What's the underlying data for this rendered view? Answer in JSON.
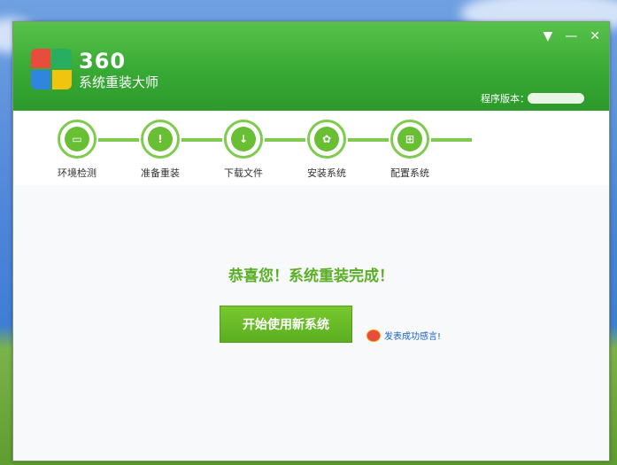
{
  "window": {
    "brand_number": "360",
    "brand_name": "系统重装大师",
    "version_label": "程序版本：",
    "controls": {
      "menu": "▼",
      "minimize": "—",
      "close": "✕"
    }
  },
  "steps": [
    {
      "label": "环境检测",
      "icon": "monitor-icon"
    },
    {
      "label": "准备重装",
      "icon": "document-icon"
    },
    {
      "label": "下载文件",
      "icon": "download-icon"
    },
    {
      "label": "安装系统",
      "icon": "gear-icon"
    },
    {
      "label": "配置系统",
      "icon": "windows-icon"
    }
  ],
  "main": {
    "congrats": "恭喜您！系统重装完成！",
    "start_button": "开始使用新系统",
    "weibo_link": "发表成功感言!"
  },
  "colors": {
    "accent": "#5aae1f",
    "titlebar": "#38a935",
    "link": "#1a62c7"
  }
}
